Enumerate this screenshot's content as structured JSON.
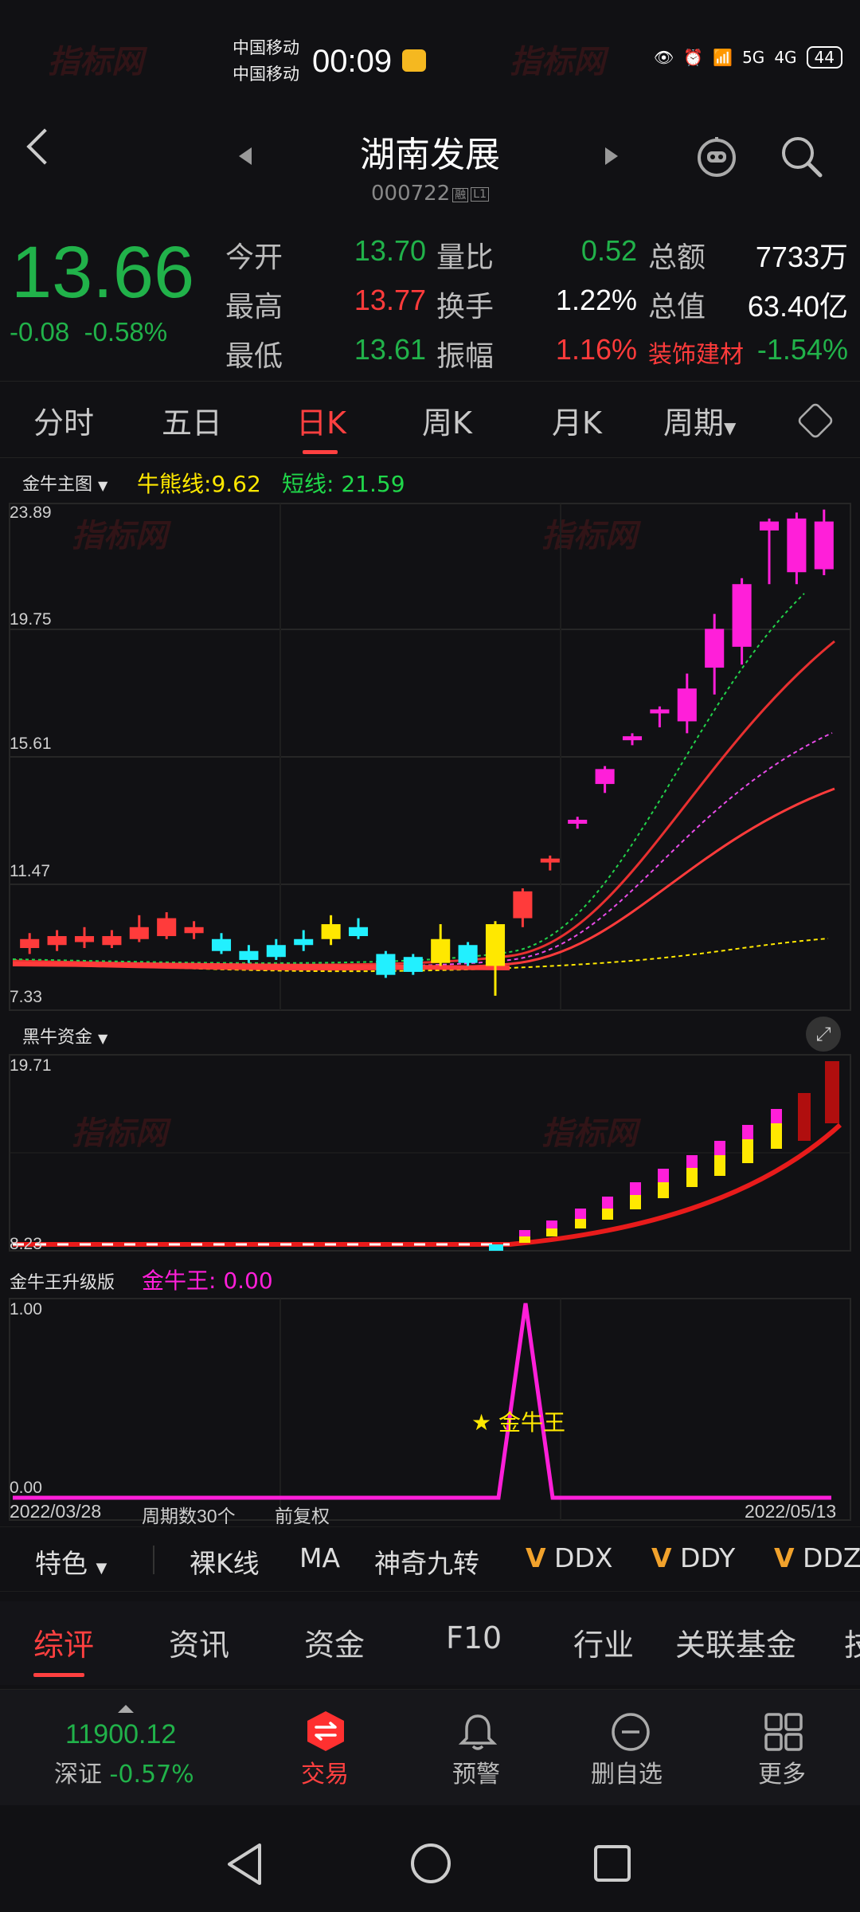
{
  "status_bar": {
    "carrier1": "中国移动",
    "carrier2": "中国移动",
    "time": "00:09",
    "signal1": "5G",
    "signal2": "4G",
    "battery": "44"
  },
  "header": {
    "stock_name": "湖南发展",
    "stock_code": "000722",
    "tag1": "融",
    "tag2": "L1"
  },
  "quote": {
    "price": "13.66",
    "change": "-0.08",
    "change_pct": "-0.58%",
    "rows": [
      {
        "l1": "今开",
        "v1": "13.70",
        "l2": "量比",
        "v2": "0.52",
        "l3": "总额",
        "v3": "7733万"
      },
      {
        "l1": "最高",
        "v1": "13.77",
        "l2": "换手",
        "v2": "1.22%",
        "l3": "总值",
        "v3": "63.40亿"
      },
      {
        "l1": "最低",
        "v1": "13.61",
        "l2": "振幅",
        "v2": "1.16%",
        "l3": "装饰建材",
        "v3": "-1.54%"
      }
    ]
  },
  "period_tabs": [
    "分时",
    "五日",
    "日K",
    "周K",
    "月K",
    "周期"
  ],
  "main_chart": {
    "indicator_name": "金牛主图",
    "line1_label": "牛熊线:",
    "line1_value": "9.62",
    "line2_label": "短线:",
    "line2_value": "21.59",
    "y_ticks": [
      "23.89",
      "19.75",
      "15.61",
      "11.47",
      "7.33"
    ]
  },
  "sub_chart1": {
    "indicator_name": "黑牛资金",
    "y_top": "19.71",
    "y_bottom": "8.23"
  },
  "sub_chart2": {
    "indicator_name": "金牛王升级版",
    "value_label": "金牛王: 0.00",
    "y_top": "1.00",
    "y_bottom": "0.00",
    "signal_text": "★ 金牛王",
    "date_start": "2022/03/28",
    "period_count": "周期数30个",
    "adjust": "前复权",
    "date_end": "2022/05/13"
  },
  "chart_data": {
    "type": "candlestick",
    "y_range": [
      7.33,
      23.89
    ],
    "candles": [
      {
        "o": 9.2,
        "c": 9.5,
        "h": 9.7,
        "l": 9.0,
        "color": "red"
      },
      {
        "o": 9.3,
        "c": 9.6,
        "h": 9.8,
        "l": 9.1,
        "color": "red"
      },
      {
        "o": 9.4,
        "c": 9.6,
        "h": 9.9,
        "l": 9.2,
        "color": "red"
      },
      {
        "o": 9.3,
        "c": 9.6,
        "h": 9.8,
        "l": 9.2,
        "color": "red"
      },
      {
        "o": 9.5,
        "c": 9.9,
        "h": 10.3,
        "l": 9.4,
        "color": "red"
      },
      {
        "o": 9.6,
        "c": 10.2,
        "h": 10.4,
        "l": 9.5,
        "color": "red"
      },
      {
        "o": 9.7,
        "c": 9.9,
        "h": 10.1,
        "l": 9.5,
        "color": "red"
      },
      {
        "o": 9.5,
        "c": 9.1,
        "h": 9.7,
        "l": 9.0,
        "color": "cyan"
      },
      {
        "o": 9.1,
        "c": 8.8,
        "h": 9.3,
        "l": 8.7,
        "color": "cyan"
      },
      {
        "o": 9.3,
        "c": 8.9,
        "h": 9.5,
        "l": 8.8,
        "color": "cyan"
      },
      {
        "o": 9.5,
        "c": 9.3,
        "h": 9.8,
        "l": 9.1,
        "color": "cyan"
      },
      {
        "o": 9.5,
        "c": 10.0,
        "h": 10.3,
        "l": 9.3,
        "color": "yellow"
      },
      {
        "o": 9.9,
        "c": 9.6,
        "h": 10.2,
        "l": 9.5,
        "color": "cyan"
      },
      {
        "o": 9.0,
        "c": 8.3,
        "h": 9.1,
        "l": 8.2,
        "color": "cyan"
      },
      {
        "o": 8.9,
        "c": 8.4,
        "h": 9.0,
        "l": 8.3,
        "color": "cyan"
      },
      {
        "o": 8.7,
        "c": 9.5,
        "h": 10.0,
        "l": 8.6,
        "color": "yellow"
      },
      {
        "o": 9.3,
        "c": 8.7,
        "h": 9.4,
        "l": 8.6,
        "color": "cyan"
      },
      {
        "o": 8.6,
        "c": 10.0,
        "h": 10.1,
        "l": 7.6,
        "color": "yellow"
      },
      {
        "o": 10.2,
        "c": 11.1,
        "h": 11.2,
        "l": 9.9,
        "color": "red"
      },
      {
        "o": 12.1,
        "c": 12.2,
        "h": 12.3,
        "l": 11.8,
        "color": "red"
      },
      {
        "o": 13.4,
        "c": 13.5,
        "h": 13.6,
        "l": 13.2,
        "color": "magenta"
      },
      {
        "o": 14.7,
        "c": 15.2,
        "h": 15.3,
        "l": 14.4,
        "color": "magenta"
      },
      {
        "o": 16.2,
        "c": 16.3,
        "h": 16.4,
        "l": 16.0,
        "color": "magenta"
      },
      {
        "o": 17.1,
        "c": 17.2,
        "h": 17.3,
        "l": 16.6,
        "color": "magenta"
      },
      {
        "o": 16.8,
        "c": 17.9,
        "h": 18.4,
        "l": 16.4,
        "color": "magenta"
      },
      {
        "o": 18.6,
        "c": 19.9,
        "h": 20.4,
        "l": 17.7,
        "color": "magenta"
      },
      {
        "o": 19.3,
        "c": 21.4,
        "h": 21.6,
        "l": 18.7,
        "color": "magenta"
      },
      {
        "o": 23.5,
        "c": 23.2,
        "h": 23.6,
        "l": 21.4,
        "color": "magenta"
      },
      {
        "o": 23.6,
        "c": 21.8,
        "h": 23.8,
        "l": 21.4,
        "color": "magenta"
      },
      {
        "o": 23.5,
        "c": 21.9,
        "h": 23.9,
        "l": 21.7,
        "color": "magenta"
      }
    ]
  },
  "indicator_toolbar": {
    "special": "特色",
    "items": [
      "裸K线",
      "MA",
      "神奇九转",
      "DDX",
      "DDY",
      "DDZ"
    ]
  },
  "section_tabs": [
    "综评",
    "资讯",
    "资金",
    "F10",
    "行业",
    "关联基金",
    "技"
  ],
  "bottom_nav": {
    "index_value": "11900.12",
    "index_name": "深证",
    "index_change": "-0.57%",
    "items": [
      "交易",
      "预警",
      "删自选",
      "更多"
    ]
  },
  "watermark_text": "指标网",
  "colors": {
    "up": "#ff3b3b",
    "down": "#21b24a",
    "accent": "#ff4040",
    "magenta": "#ff1fd9",
    "cyan": "#22f0ff",
    "yellow": "#ffe800"
  }
}
